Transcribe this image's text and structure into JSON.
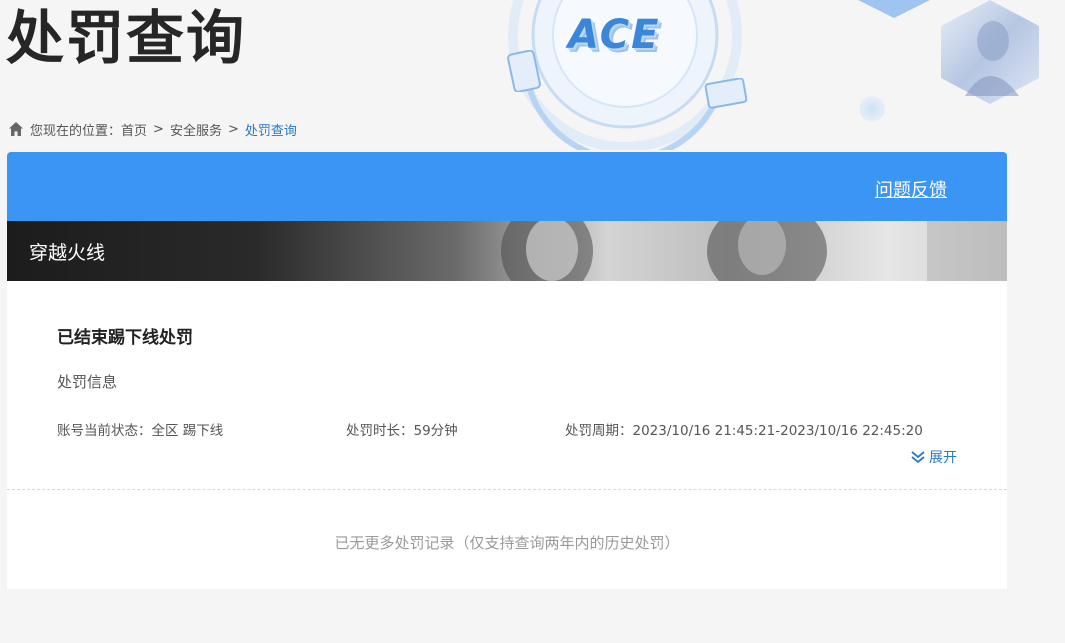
{
  "header": {
    "title": "处罚查询"
  },
  "breadcrumb": {
    "prefix": "您现在的位置：",
    "items": [
      "首页",
      "安全服务",
      "处罚查询"
    ],
    "separator": ">"
  },
  "panel": {
    "feedback_link": "问题反馈",
    "game_name": "穿越火线"
  },
  "record": {
    "title": "已结束踢下线处罚",
    "subtitle": "处罚信息",
    "status_label": "账号当前状态：全区 踢下线",
    "duration_label": "处罚时长：59分钟",
    "period_label": "处罚周期：2023/10/16 21:45:21-2023/10/16 22:45:20",
    "expand_label": "展开"
  },
  "footer": {
    "note": "已无更多处罚记录（仅支持查询两年内的历史处罚）"
  },
  "colors": {
    "accent": "#3a95f5",
    "link": "#2a78c8"
  }
}
